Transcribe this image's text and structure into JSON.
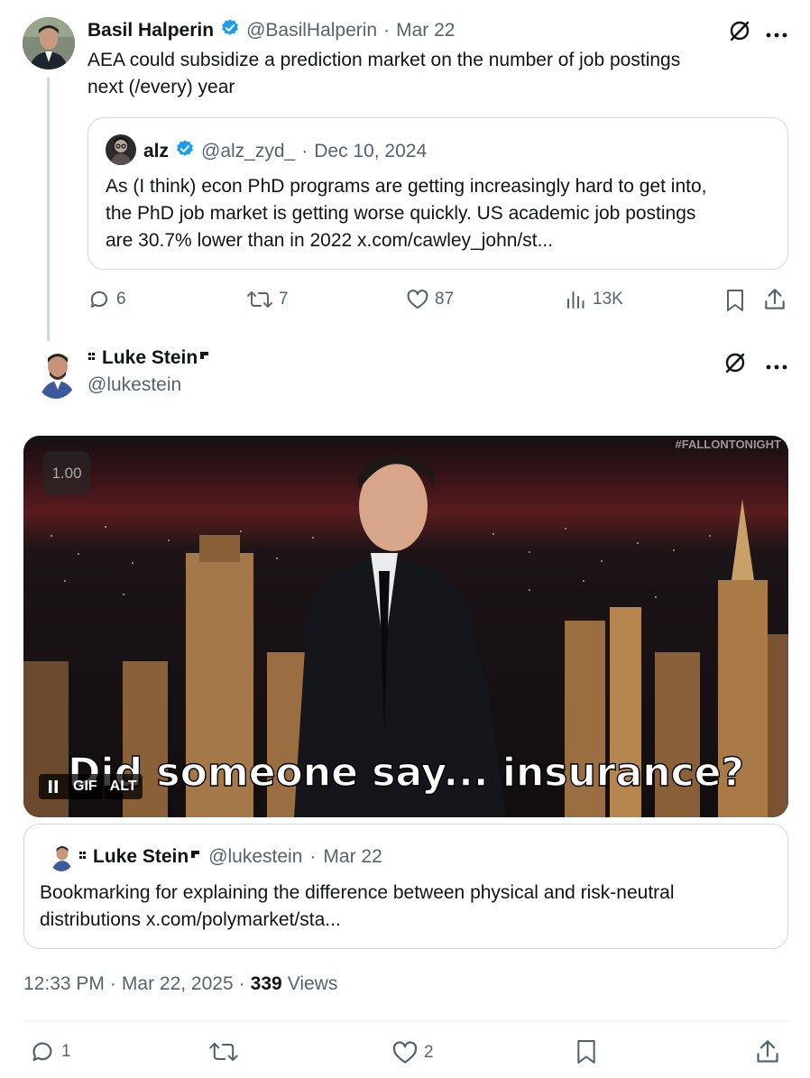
{
  "tweet1": {
    "author_name": "Basil Halperin",
    "handle": "@BasilHalperin",
    "sep": "·",
    "date": "Mar 22",
    "text_line1": "AEA could subsidize a prediction market on the number of job postings",
    "text_line2": "next (/every) year",
    "quote": {
      "author_name": "alz",
      "handle": "@alz_zyd_",
      "sep": "·",
      "date": "Dec 10, 2024",
      "line1": "As (I think) econ PhD programs are getting increasingly hard to get into,",
      "line2": "the PhD job market is getting worse quickly. US academic job postings",
      "line3": "are 30.7% lower than in 2022 x.com/cawley_john/st..."
    },
    "actions": {
      "replies": "6",
      "reposts": "7",
      "likes": "87",
      "views": "13K"
    }
  },
  "tweet2": {
    "author_name": "Luke Stein",
    "handle": "@lukestein",
    "media": {
      "speed_label": "1.00",
      "caption": "Did someone say... insurance?",
      "watermark": "#FALLONTONIGHT",
      "gif_badge": "GIF",
      "alt_badge": "ALT"
    },
    "quote": {
      "author_name": "Luke Stein",
      "handle": "@lukestein",
      "sep": "·",
      "date": "Mar 22",
      "line1": "Bookmarking for explaining the difference between physical and risk-neutral",
      "line2": "distributions x.com/polymarket/sta..."
    },
    "meta": {
      "time": "12:33 PM",
      "sep1": "·",
      "date": "Mar 22, 2025",
      "sep2": "·",
      "views_count": "339",
      "views_label": "Views"
    },
    "actions": {
      "replies": "1",
      "likes": "2"
    }
  },
  "colors": {
    "verified": "#1d9bf0",
    "muted": "#536471",
    "border": "#cfd9de"
  }
}
